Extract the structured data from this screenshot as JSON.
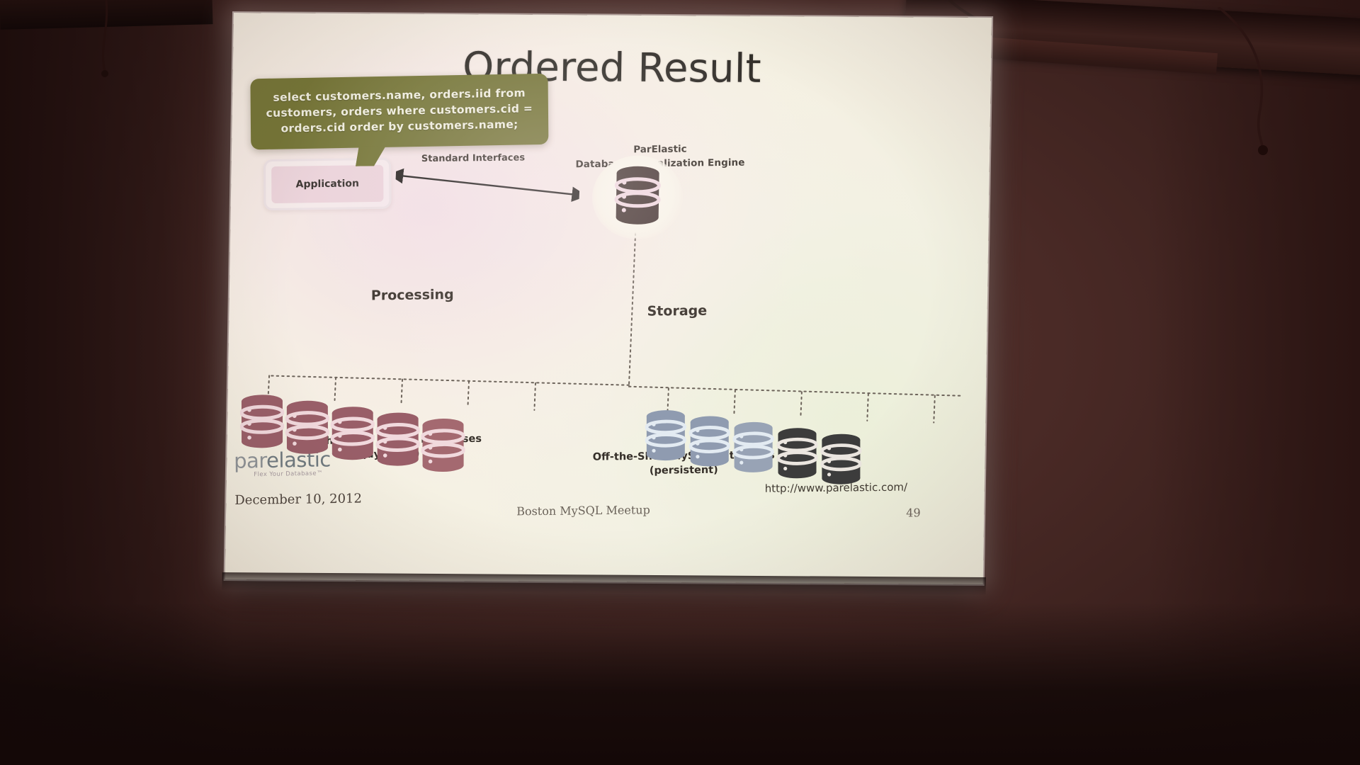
{
  "scene": {
    "description": "Projected conference slide on a screen in a dark room",
    "wall_color": "#4a2a26",
    "screen_color": "#fdf8ec"
  },
  "slide": {
    "title": "Ordered Result",
    "bubble": {
      "query": "select customers.name, orders.iid from\ncustomers, orders where customers.cid =\norders.cid order by customers.name;",
      "bg_color": "#74752f",
      "text_color": "#f3f1e0"
    },
    "engine": {
      "line1": "ParElastic",
      "line2": "Database Virtualization Engine",
      "icon": "database-icon"
    },
    "application": {
      "label": "Application",
      "box_color": "#f0d5dd"
    },
    "interfaces": {
      "label": "Standard Interfaces",
      "arrow": "double-arrow-icon"
    },
    "sections": {
      "processing": "Processing",
      "storage": "Storage"
    },
    "captions": {
      "dynamic": "Off-the-Shelf MySQL Databases\n(dynamic)",
      "persistent": "Off-the-Shelf MySQL Databases\n(persistent)"
    },
    "processing_nodes": [
      {
        "id": 1,
        "color": "#9e5c67",
        "band": "#f6dbe0"
      },
      {
        "id": 2,
        "color": "#9e5c67",
        "band": "#f6dbe0"
      },
      {
        "id": 3,
        "color": "#9e5c67",
        "band": "#f6dbe0"
      },
      {
        "id": 4,
        "color": "#9e5c67",
        "band": "#f6dbe0"
      },
      {
        "id": 5,
        "color": "#a9676f",
        "band": "#f6dbe0"
      }
    ],
    "storage_nodes": [
      {
        "id": 1,
        "color": "#8e9cb4",
        "band": "#e6eef6"
      },
      {
        "id": 2,
        "color": "#8e9cb4",
        "band": "#e6eef6"
      },
      {
        "id": 3,
        "color": "#98a4b8",
        "band": "#e6eef6"
      },
      {
        "id": 4,
        "color": "#3a3a3a",
        "band": "#efe9e2"
      },
      {
        "id": 5,
        "color": "#3a3a3a",
        "band": "#efe9e2"
      }
    ],
    "logo": {
      "word_a": "par",
      "word_b": "elastic",
      "tagline": "Flex Your Database™"
    },
    "footer": {
      "date": "December 10, 2012",
      "venue": "Boston MySQL Meetup",
      "url": "http://www.parelastic.com/",
      "page": "49"
    }
  }
}
